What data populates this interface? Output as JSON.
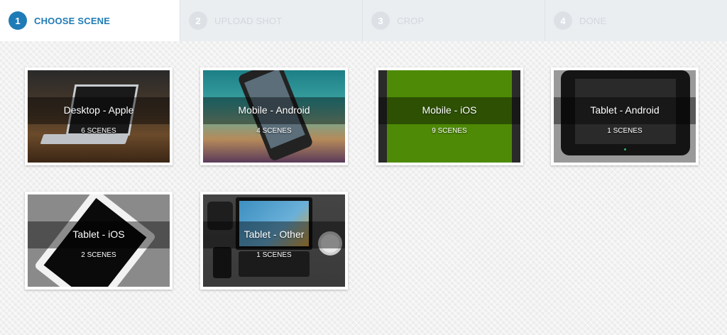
{
  "steps": [
    {
      "num": "1",
      "label": "CHOOSE SCENE",
      "active": true
    },
    {
      "num": "2",
      "label": "UPLOAD SHOT",
      "active": false
    },
    {
      "num": "3",
      "label": "CROP",
      "active": false
    },
    {
      "num": "4",
      "label": "DONE",
      "active": false
    }
  ],
  "scenes": [
    {
      "title": "Desktop - Apple",
      "count": "6 SCENES",
      "image": "laptop-on-desk"
    },
    {
      "title": "Mobile - Android",
      "count": "4 SCENES",
      "image": "android-phone"
    },
    {
      "title": "Mobile - iOS",
      "count": "9 SCENES",
      "image": "iphone-green"
    },
    {
      "title": "Tablet - Android",
      "count": "1 SCENES",
      "image": "android-tablet"
    },
    {
      "title": "Tablet - iOS",
      "count": "2 SCENES",
      "image": "ipad"
    },
    {
      "title": "Tablet - Other",
      "count": "1 SCENES",
      "image": "tablet-keyboard-desk"
    }
  ],
  "colors": {
    "accent": "#1f7bb6",
    "inactive_step": "#d3d7dc"
  }
}
